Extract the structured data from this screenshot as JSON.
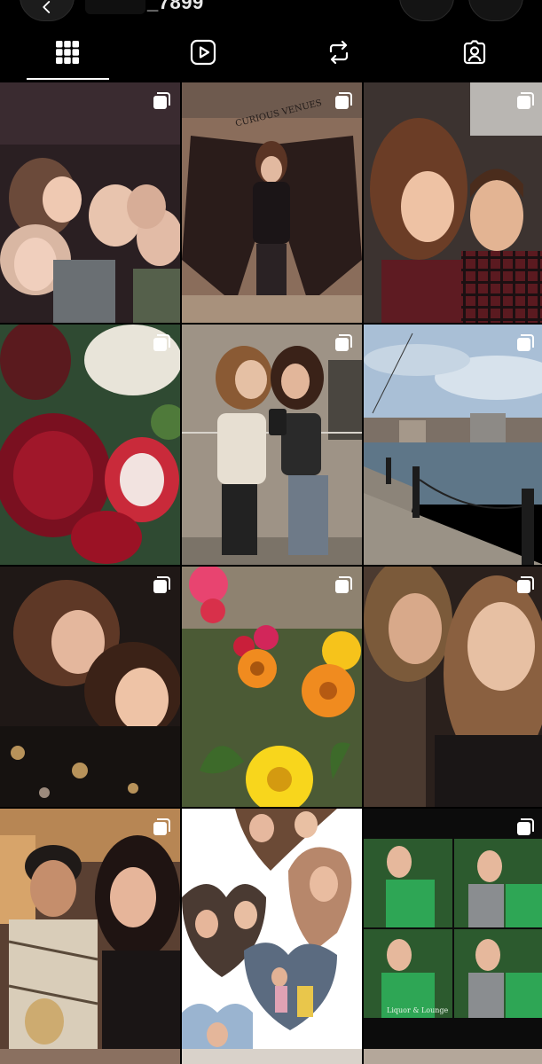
{
  "header": {
    "username_suffix": "_7899",
    "back_icon": "arrow-left-icon",
    "notify_icon": "bell-icon",
    "menu_icon": "more-icon"
  },
  "tabs": [
    {
      "name": "grid",
      "icon": "grid-icon",
      "active": true
    },
    {
      "name": "reels",
      "icon": "reels-icon",
      "active": false
    },
    {
      "name": "reposts",
      "icon": "repost-icon",
      "active": false
    },
    {
      "name": "tagged",
      "icon": "tagged-icon",
      "active": false
    }
  ],
  "grid": {
    "posts": [
      {
        "desc": "group night out",
        "multi": "carousel-icon"
      },
      {
        "desc": "curious venues wings mural",
        "wall_text": "CURIOUS VENUES",
        "multi": "carousel-icon"
      },
      {
        "desc": "couple selfie",
        "multi": "carousel-icon"
      },
      {
        "desc": "red flowers bouquet",
        "multi": "carousel-icon"
      },
      {
        "desc": "mirror selfie two friends",
        "multi": "carousel-icon"
      },
      {
        "desc": "harbour waterfront",
        "multi": "carousel-icon"
      },
      {
        "desc": "friends selfie dark",
        "multi": "carousel-icon"
      },
      {
        "desc": "orange and yellow flowers",
        "multi": "carousel-icon"
      },
      {
        "desc": "two friends close selfie",
        "multi": "carousel-icon"
      },
      {
        "desc": "friends in bar",
        "multi": "carousel-icon"
      },
      {
        "desc": "heart collage",
        "multi": "reel-icon"
      },
      {
        "desc": "photobooth strip",
        "booth_text": "Liquor & Lounge",
        "multi": "carousel-icon"
      }
    ]
  },
  "colors": {
    "background": "#000000",
    "icon": "#ffffff"
  }
}
